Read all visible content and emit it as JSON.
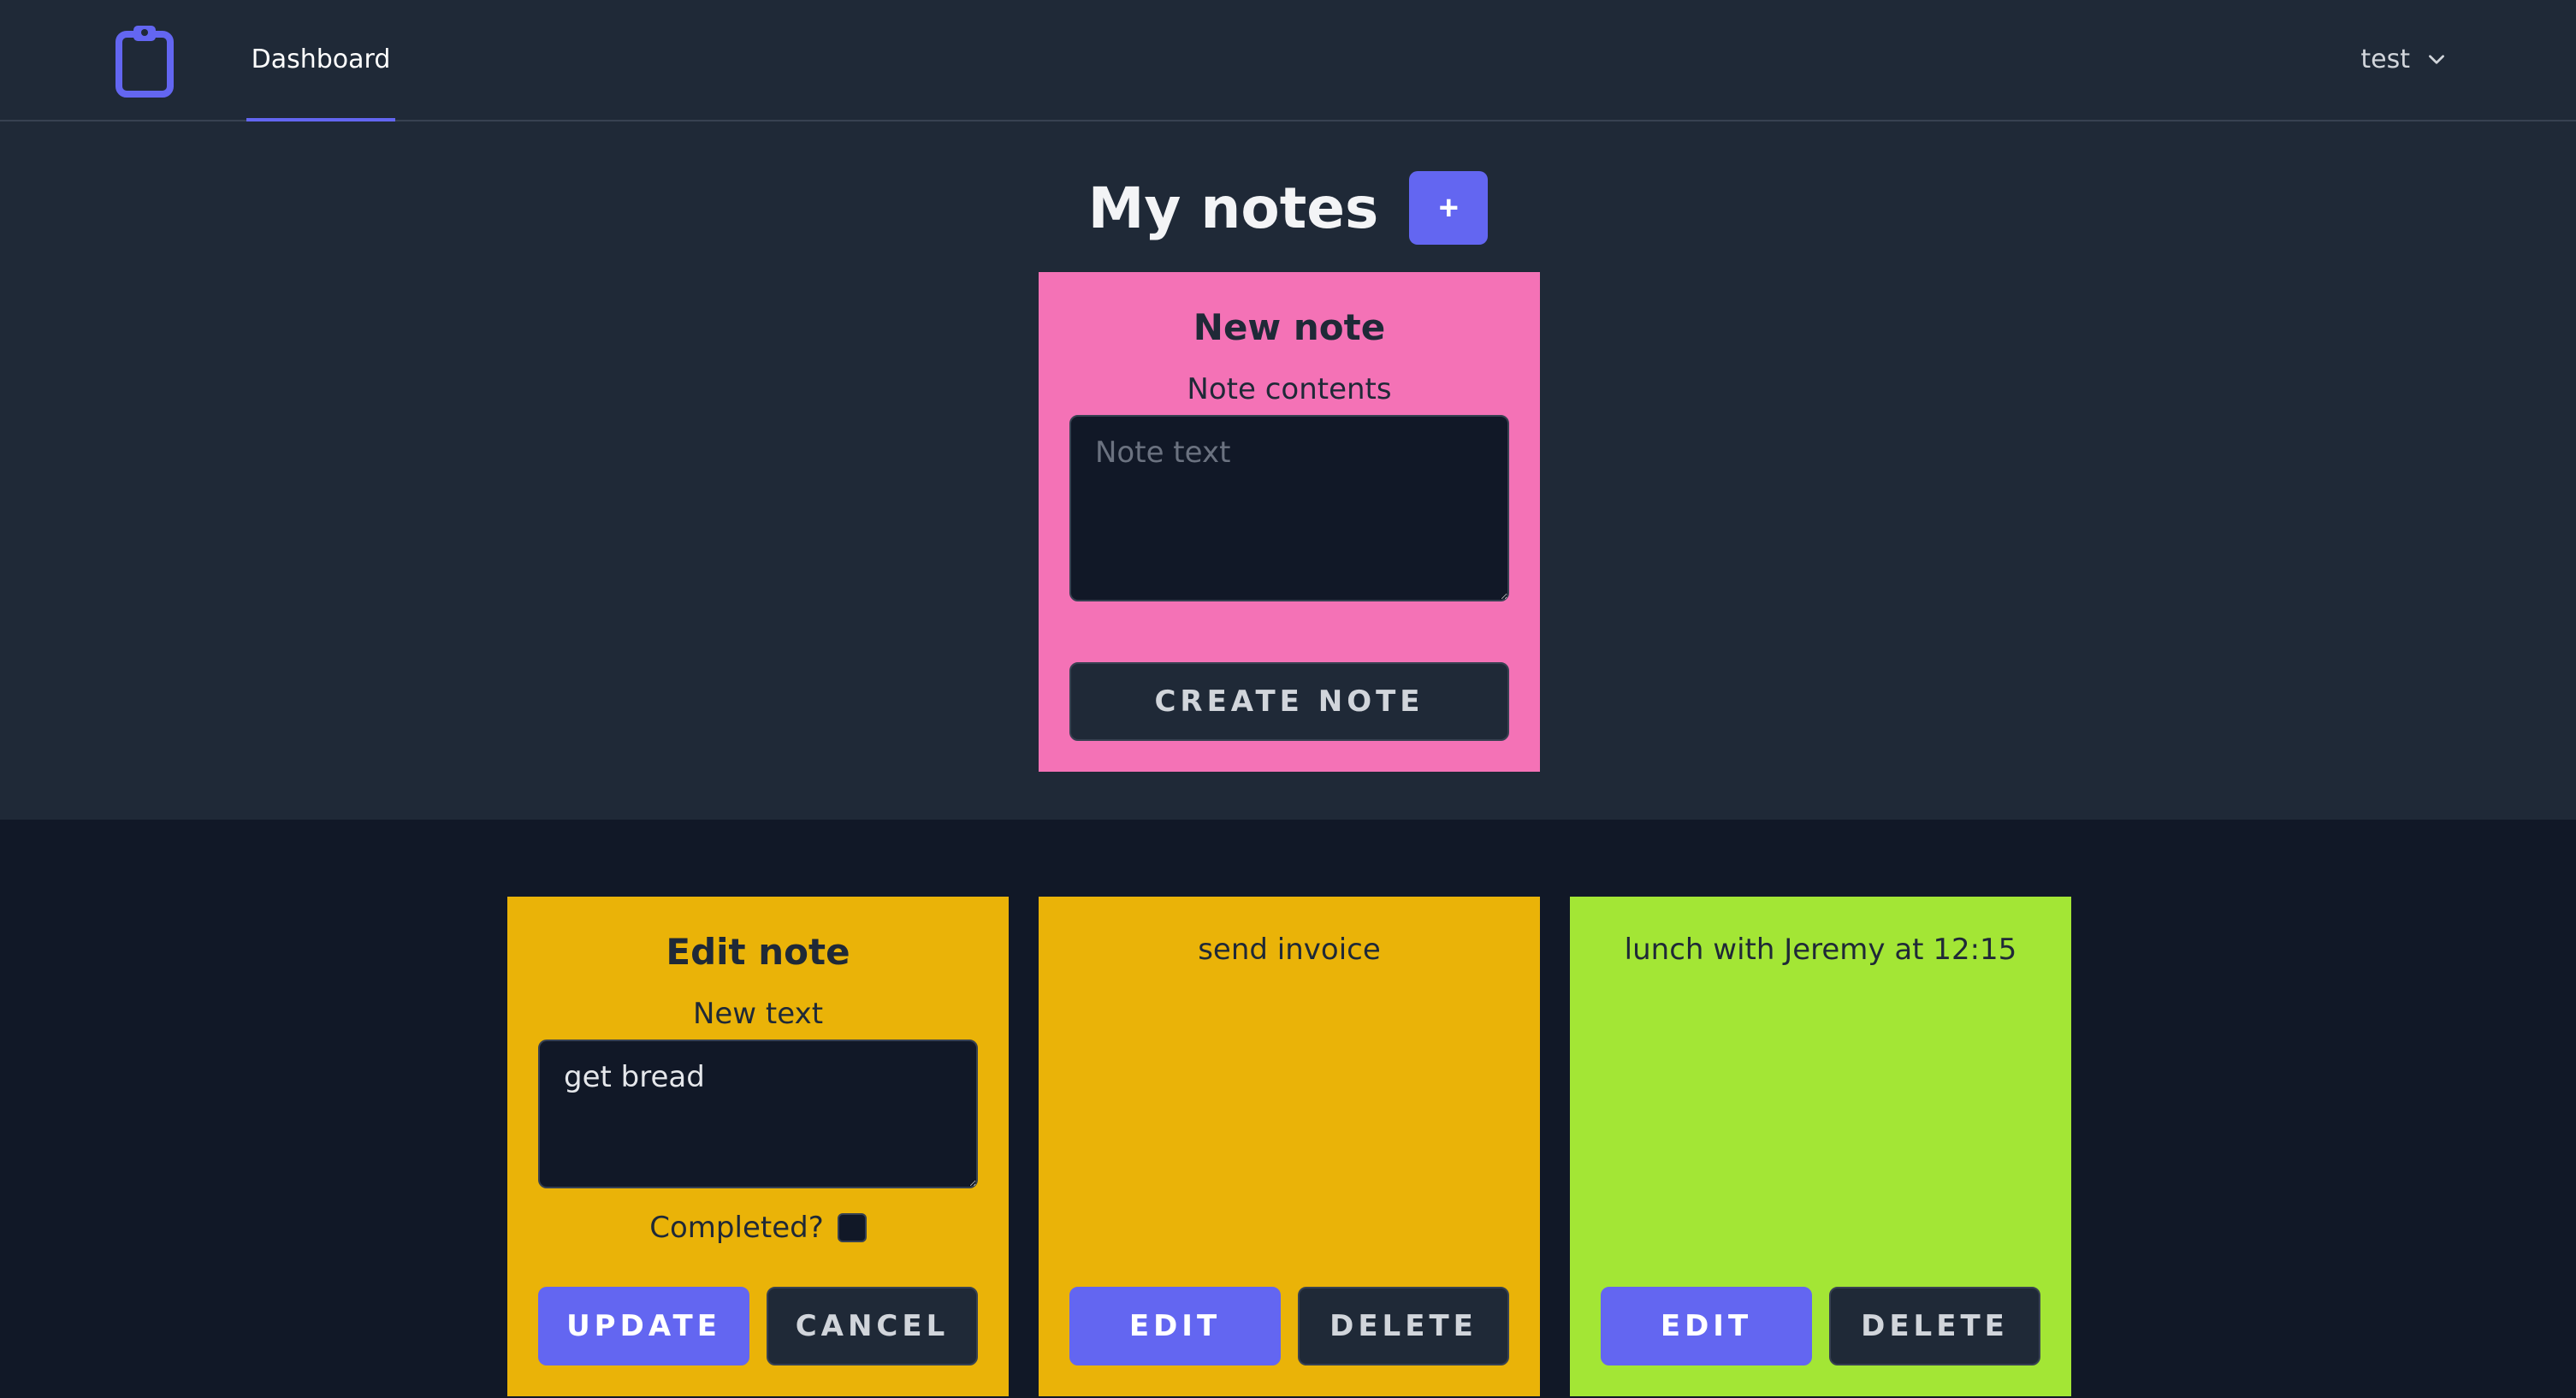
{
  "nav": {
    "tab_dashboard": "Dashboard",
    "user_name": "test"
  },
  "header": {
    "title": "My notes",
    "add_label": "+"
  },
  "new_note": {
    "title": "New note",
    "label": "Note contents",
    "placeholder": "Note text",
    "create_label": "CREATE NOTE"
  },
  "edit_note": {
    "title": "Edit note",
    "label": "New text",
    "value": "get bread",
    "completed_label": "Completed?",
    "update_label": "UPDATE",
    "cancel_label": "CANCEL"
  },
  "notes": [
    {
      "text": "send invoice",
      "edit_label": "EDIT",
      "delete_label": "DELETE",
      "color": "#eab308"
    },
    {
      "text": "lunch with Jeremy at 12:15",
      "edit_label": "EDIT",
      "delete_label": "DELETE",
      "color": "#a3e635"
    }
  ],
  "colors": {
    "accent": "#6366f1",
    "new_note_card": "#f472b6",
    "edit_note_card": "#eab308",
    "nav_bg": "#1f2937",
    "page_bg": "#111827"
  },
  "icons": {
    "logo": "clipboard-icon",
    "user_menu": "chevron-down-icon"
  }
}
